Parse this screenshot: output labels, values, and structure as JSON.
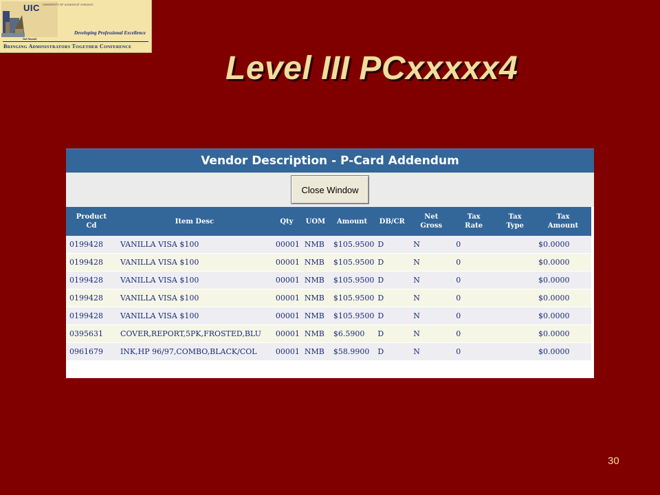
{
  "logo": {
    "uic": "UIC",
    "univ": "UNIVERSITY OF ILLINOIS AT CHICAGO",
    "annual": "2nd Annual",
    "tagline": "Developing Professional Excellence",
    "conference": "Bringing Administrators Together Conference"
  },
  "slide": {
    "title": "Level III PCxxxxx4",
    "number": "30"
  },
  "window": {
    "header": "Vendor Description - P-Card Addendum",
    "close_button": "Close Window",
    "columns": [
      {
        "l1": "Product",
        "l2": "Cd"
      },
      {
        "l1": "Item Desc",
        "l2": ""
      },
      {
        "l1": "Qty",
        "l2": ""
      },
      {
        "l1": "UOM",
        "l2": ""
      },
      {
        "l1": "Amount",
        "l2": ""
      },
      {
        "l1": "DB/CR",
        "l2": ""
      },
      {
        "l1": "Net",
        "l2": "Gross"
      },
      {
        "l1": "Tax",
        "l2": "Rate"
      },
      {
        "l1": "Tax",
        "l2": "Type"
      },
      {
        "l1": "Tax",
        "l2": "Amount"
      }
    ],
    "rows": [
      [
        "0199428",
        "VANILLA VISA $100",
        "00001",
        "NMB",
        "$105.9500",
        "D",
        "N",
        "0",
        "",
        "$0.0000"
      ],
      [
        "0199428",
        "VANILLA VISA $100",
        "00001",
        "NMB",
        "$105.9500",
        "D",
        "N",
        "0",
        "",
        "$0.0000"
      ],
      [
        "0199428",
        "VANILLA VISA $100",
        "00001",
        "NMB",
        "$105.9500",
        "D",
        "N",
        "0",
        "",
        "$0.0000"
      ],
      [
        "0199428",
        "VANILLA VISA $100",
        "00001",
        "NMB",
        "$105.9500",
        "D",
        "N",
        "0",
        "",
        "$0.0000"
      ],
      [
        "0199428",
        "VANILLA VISA $100",
        "00001",
        "NMB",
        "$105.9500",
        "D",
        "N",
        "0",
        "",
        "$0.0000"
      ],
      [
        "0395631",
        "COVER,REPORT,5PK,FROSTED,BLU",
        "00001",
        "NMB",
        "$6.5900",
        "D",
        "N",
        "0",
        "",
        "$0.0000"
      ],
      [
        "0961679",
        "INK,HP 96/97,COMBO,BLACK/COL",
        "00001",
        "NMB",
        "$58.9900",
        "D",
        "N",
        "0",
        "",
        "$0.0000"
      ]
    ]
  },
  "colors": {
    "background": "#800000",
    "title": "#f1dd9e",
    "header_blue": "#336699"
  }
}
